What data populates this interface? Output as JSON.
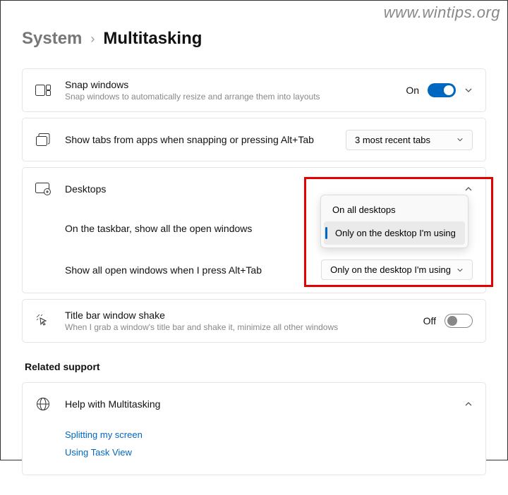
{
  "watermark": "www.wintips.org",
  "breadcrumb": {
    "parent": "System",
    "current": "Multitasking"
  },
  "snap": {
    "title": "Snap windows",
    "desc": "Snap windows to automatically resize and arrange them into layouts",
    "state": "On"
  },
  "tabs": {
    "title": "Show tabs from apps when snapping or pressing Alt+Tab",
    "value": "3 most recent tabs"
  },
  "desktops": {
    "title": "Desktops",
    "row1": {
      "label": "On the taskbar, show all the open windows"
    },
    "row2": {
      "label": "Show all open windows when I press Alt+Tab",
      "value": "Only on the desktop I'm using"
    },
    "popup": {
      "option1": "On all desktops",
      "option2": "Only on the desktop I'm using"
    }
  },
  "shake": {
    "title": "Title bar window shake",
    "desc": "When I grab a window's title bar and shake it, minimize all other windows",
    "state": "Off"
  },
  "related": {
    "heading": "Related support",
    "help_title": "Help with Multitasking",
    "link1": "Splitting my screen",
    "link2": "Using Task View"
  }
}
